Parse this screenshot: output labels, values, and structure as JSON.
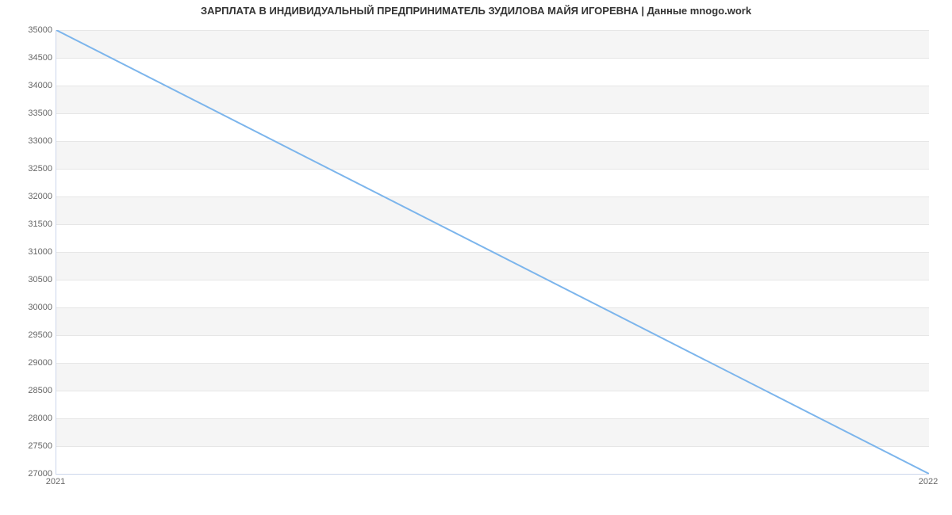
{
  "chart_data": {
    "type": "line",
    "title": "ЗАРПЛАТА В ИНДИВИДУАЛЬНЫЙ ПРЕДПРИНИМАТЕЛЬ ЗУДИЛОВА МАЙЯ ИГОРЕВНА | Данные mnogo.work",
    "xlabel": "",
    "ylabel": "",
    "x": [
      2021,
      2022
    ],
    "values": [
      35000,
      27000
    ],
    "x_ticks": [
      2021,
      2022
    ],
    "y_ticks": [
      27000,
      27500,
      28000,
      28500,
      29000,
      29500,
      30000,
      30500,
      31000,
      31500,
      32000,
      32500,
      33000,
      33500,
      34000,
      34500,
      35000
    ],
    "ylim": [
      27000,
      35000
    ]
  }
}
